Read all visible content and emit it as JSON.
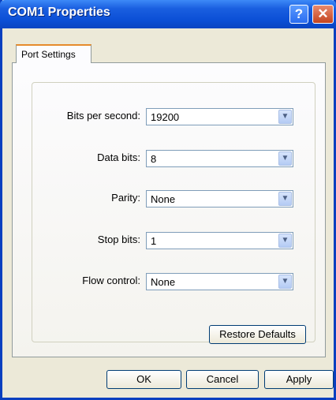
{
  "window": {
    "title": "COM1 Properties"
  },
  "titlebar": {
    "help_glyph": "?",
    "close_glyph": "✕",
    "help_icon": "help-icon",
    "close_icon": "close-icon"
  },
  "tabs": [
    {
      "label": "Port Settings",
      "selected": true
    }
  ],
  "fields": {
    "bits_per_second": {
      "label": "Bits per second:",
      "value": "19200"
    },
    "data_bits": {
      "label": "Data bits:",
      "value": "8"
    },
    "parity": {
      "label": "Parity:",
      "value": "None"
    },
    "stop_bits": {
      "label": "Stop bits:",
      "value": "1"
    },
    "flow_control": {
      "label": "Flow control:",
      "value": "None"
    }
  },
  "buttons": {
    "restore_defaults": "Restore Defaults",
    "ok": "OK",
    "cancel": "Cancel",
    "apply": "Apply"
  },
  "dropdown_arrow": "▼",
  "colors": {
    "titlebar": "#0b4fd6",
    "dialog_bg": "#ece9d8",
    "tab_accent": "#e68b2c",
    "close_button": "#c4441f"
  }
}
